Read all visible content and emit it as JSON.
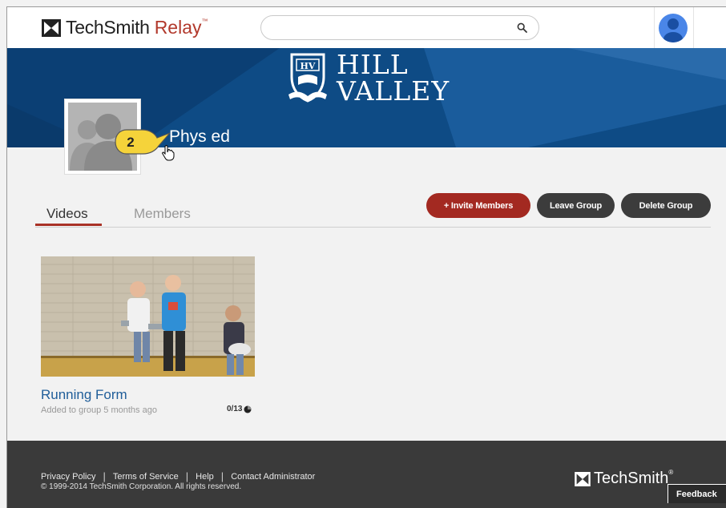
{
  "header": {
    "brand": "TechSmith",
    "product": "Relay",
    "trademark": "™",
    "search": {
      "value": "",
      "placeholder": ""
    }
  },
  "banner": {
    "school_line1": "HILL",
    "school_line2": "VALLEY",
    "crest_text": "HV",
    "group_name": "Phys ed",
    "callout_number": "2"
  },
  "tabs": [
    {
      "label": "Videos",
      "active": true
    },
    {
      "label": "Members",
      "active": false
    }
  ],
  "actions": {
    "invite": "+ Invite Members",
    "leave": "Leave Group",
    "delete": "Delete Group"
  },
  "videos": [
    {
      "title": "Running Form",
      "added": "Added to group 5 months ago",
      "views": "0/13"
    }
  ],
  "footer": {
    "links": [
      "Privacy Policy",
      "Terms of Service",
      "Help",
      "Contact Administrator"
    ],
    "copyright": "© 1999-2014 TechSmith Corporation. All rights reserved.",
    "brand": "TechSmith",
    "registered": "®",
    "feedback": "Feedback"
  },
  "colors": {
    "banner": "#0e4b85",
    "accent_red": "#a32921",
    "dark_button": "#3c3c3c",
    "link_blue": "#1f5d99",
    "footer": "#3a3a3a",
    "callout_yellow": "#f5d33a"
  }
}
